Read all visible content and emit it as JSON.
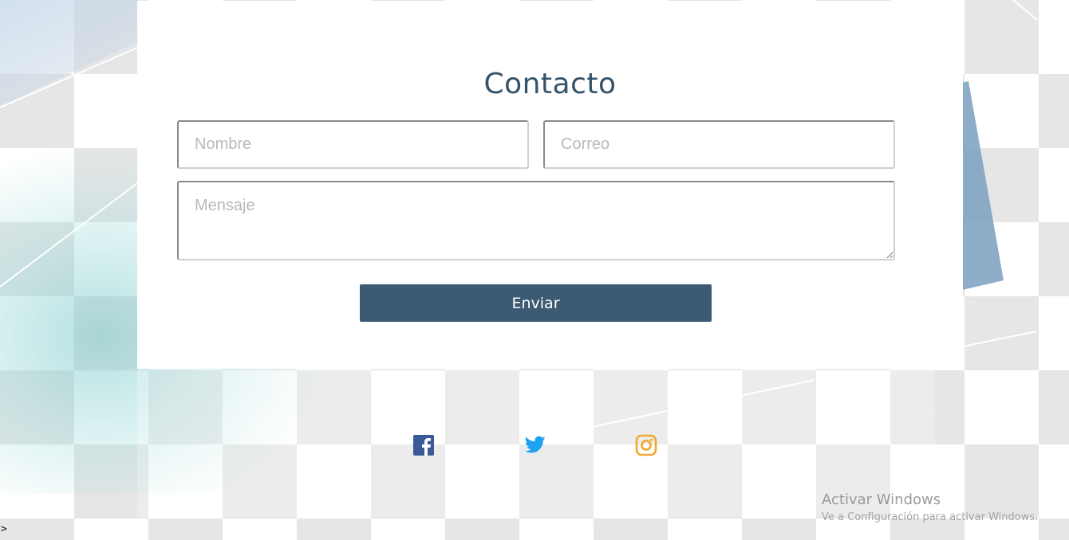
{
  "contact": {
    "title": "Contacto",
    "name_placeholder": "Nombre",
    "email_placeholder": "Correo",
    "message_placeholder": "Mensaje",
    "submit_label": "Enviar"
  },
  "social": [
    {
      "icon": "facebook-icon",
      "color": "#3b5998"
    },
    {
      "icon": "twitter-icon",
      "color": "#1da1f2"
    },
    {
      "icon": "instagram-icon",
      "color": "#f0a830"
    }
  ],
  "watermark": {
    "title": "Activar Windows",
    "subtitle": "Ve a Configuración para activar Windows."
  },
  "console_prompt": ">",
  "colors": {
    "accent": "#3d5a73",
    "title": "#34536a"
  }
}
